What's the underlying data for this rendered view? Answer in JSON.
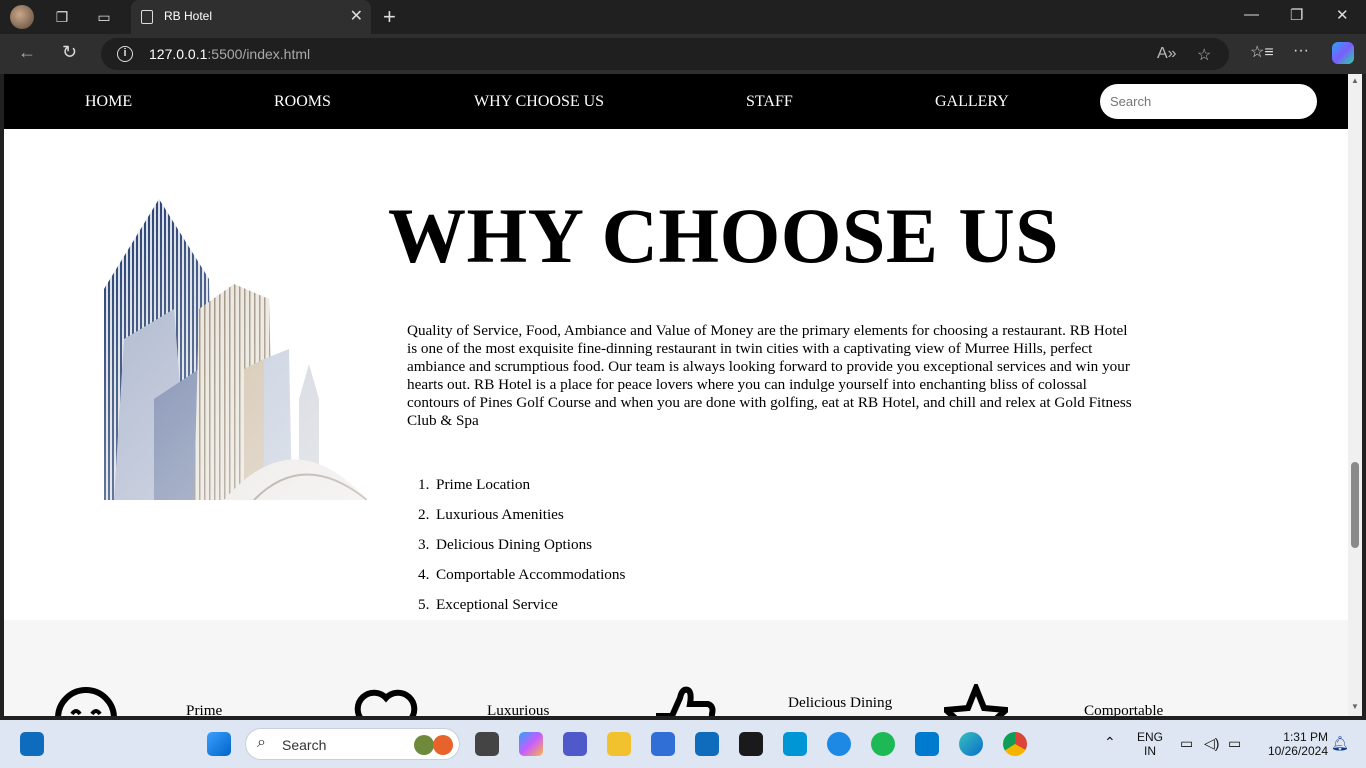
{
  "browser": {
    "tab_title": "RB Hotel",
    "url_host": "127.0.0.1",
    "url_path": ":5500/index.html"
  },
  "site": {
    "nav": [
      "HOME",
      "ROOMS",
      "WHY CHOOSE US",
      "STAFF",
      "GALLERY"
    ],
    "search_placeholder": "Search",
    "title": "WHY CHOOSE US",
    "paragraph": "Quality of Service, Food, Ambiance and Value of Money are the primary elements for choosing a restaurant. RB Hotel is one of the most exquisite fine-dinning restaurant in twin cities with a captivating view of Murree Hills, perfect ambiance and scrumptious food. Our team is always looking forward to provide you exceptional services and win your hearts out. RB Hotel is a place for peace lovers where you can indulge yourself into enchanting bliss of colossal contours of Pines Golf Course and when you are done with golfing, eat at RB Hotel, and chill and relex at Gold Fitness Club & Spa",
    "reasons": [
      "Prime Location",
      "Luxurious Amenities",
      "Delicious Dining Options",
      "Comportable Accommodations",
      "Exceptional Service"
    ],
    "features": [
      {
        "icon": "smile-icon",
        "label": "Prime"
      },
      {
        "icon": "heart-icon",
        "label": "Luxurious"
      },
      {
        "icon": "thumbs-up-icon",
        "label": "Delicious Dining"
      },
      {
        "icon": "star-icon",
        "label": "Comportable"
      }
    ]
  },
  "taskbar": {
    "search_label": "Search",
    "lang_top": "ENG",
    "lang_bottom": "IN",
    "time": "1:31 PM",
    "date": "10/26/2024"
  }
}
